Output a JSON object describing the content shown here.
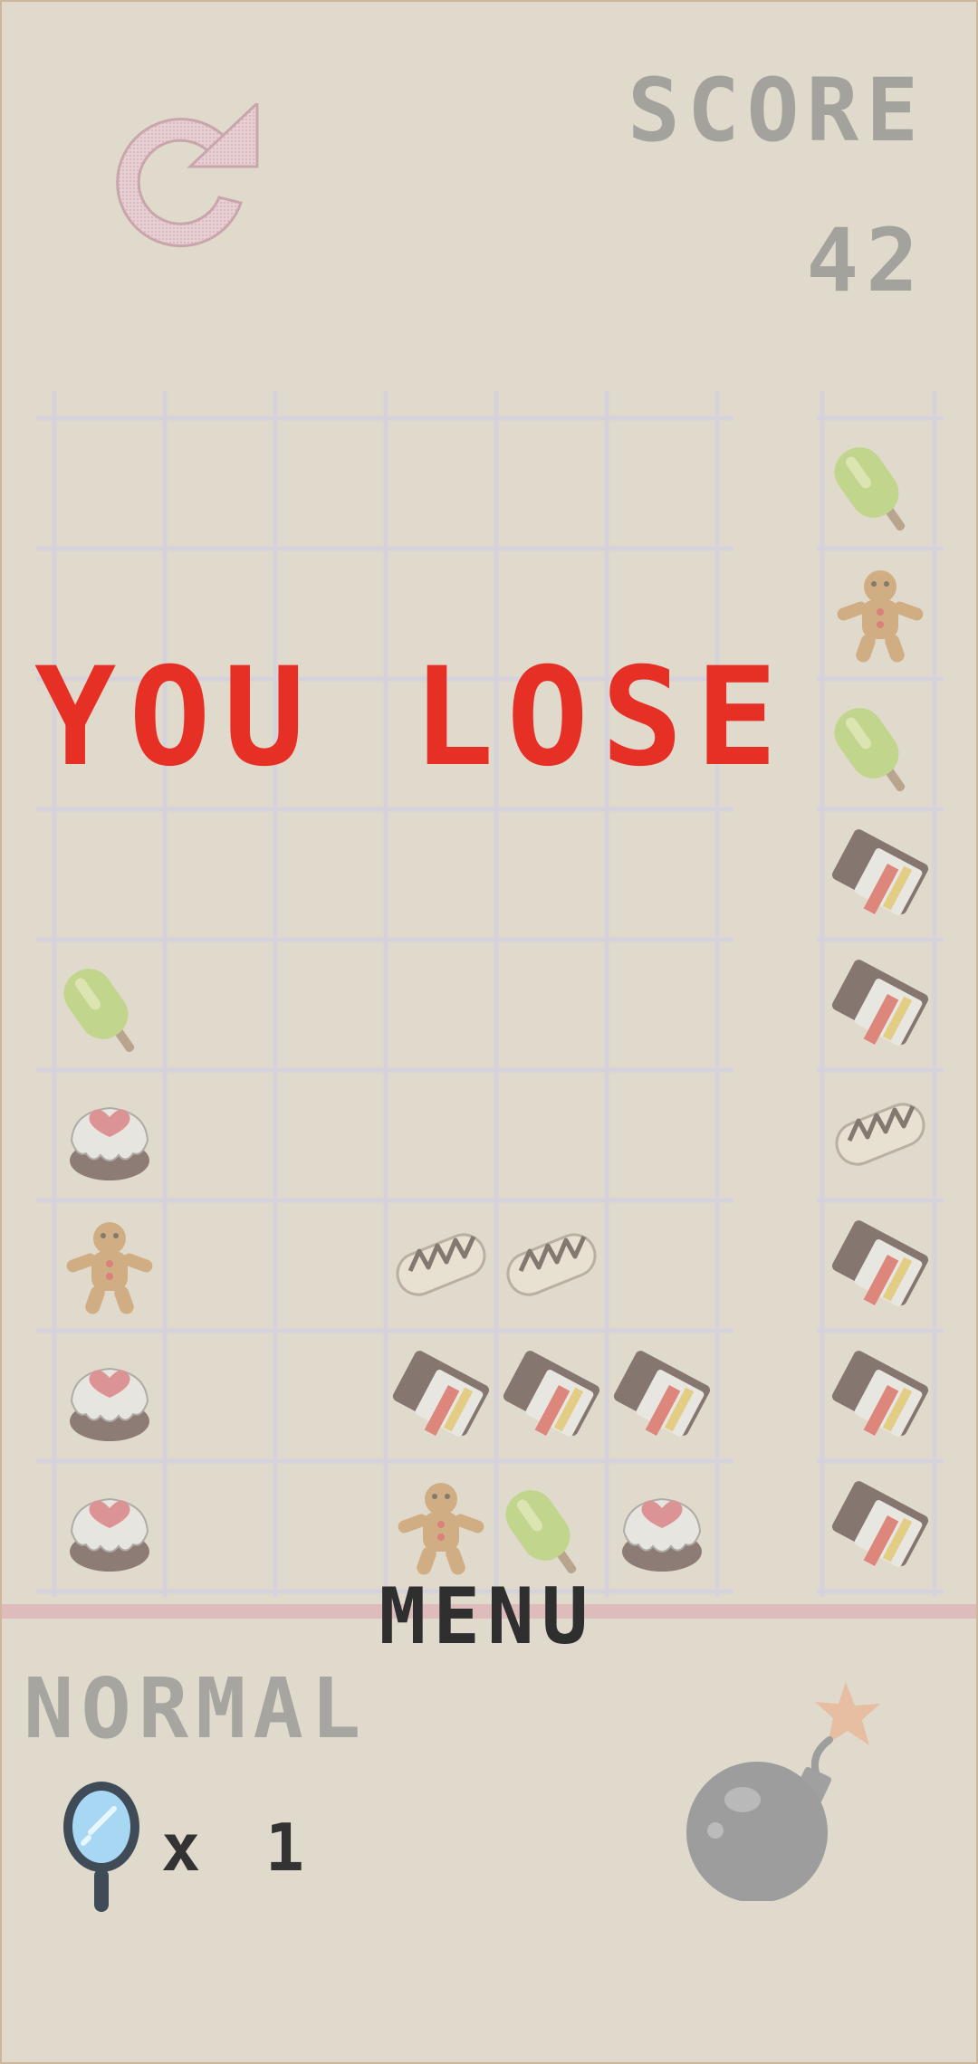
{
  "header": {
    "score_label": "SCORE",
    "score_value": "42",
    "restart_icon": "restart-icon"
  },
  "overlay": {
    "message": "YOU LOSE",
    "message_color": "#e63025"
  },
  "board": {
    "columns": 6,
    "rows": 9,
    "cells": [
      {
        "row": 4,
        "col": 0,
        "item": "popsicle"
      },
      {
        "row": 5,
        "col": 0,
        "item": "cake"
      },
      {
        "row": 6,
        "col": 0,
        "item": "gingerbread"
      },
      {
        "row": 6,
        "col": 3,
        "item": "eclair"
      },
      {
        "row": 6,
        "col": 4,
        "item": "eclair"
      },
      {
        "row": 7,
        "col": 0,
        "item": "cake"
      },
      {
        "row": 7,
        "col": 3,
        "item": "chocolate"
      },
      {
        "row": 7,
        "col": 4,
        "item": "chocolate"
      },
      {
        "row": 7,
        "col": 5,
        "item": "chocolate"
      },
      {
        "row": 8,
        "col": 0,
        "item": "cake"
      },
      {
        "row": 8,
        "col": 3,
        "item": "gingerbread"
      },
      {
        "row": 8,
        "col": 4,
        "item": "popsicle"
      },
      {
        "row": 8,
        "col": 5,
        "item": "cake"
      }
    ]
  },
  "next_queue": {
    "items": [
      "popsicle",
      "gingerbread",
      "popsicle",
      "chocolate",
      "chocolate",
      "eclair",
      "chocolate",
      "chocolate",
      "chocolate"
    ]
  },
  "footer": {
    "menu_label": "MENU",
    "difficulty_label": "NORMAL",
    "powerup_icon": "magnifier-icon",
    "powerup_count": "x 1",
    "bomb_icon": "bomb-icon"
  },
  "colors": {
    "background": "#e0dacd",
    "grid": "#d6d2dc",
    "danger_line": "#dfbcbc",
    "score_text": "#a3a29d",
    "menu_text": "#2f2f2f"
  }
}
